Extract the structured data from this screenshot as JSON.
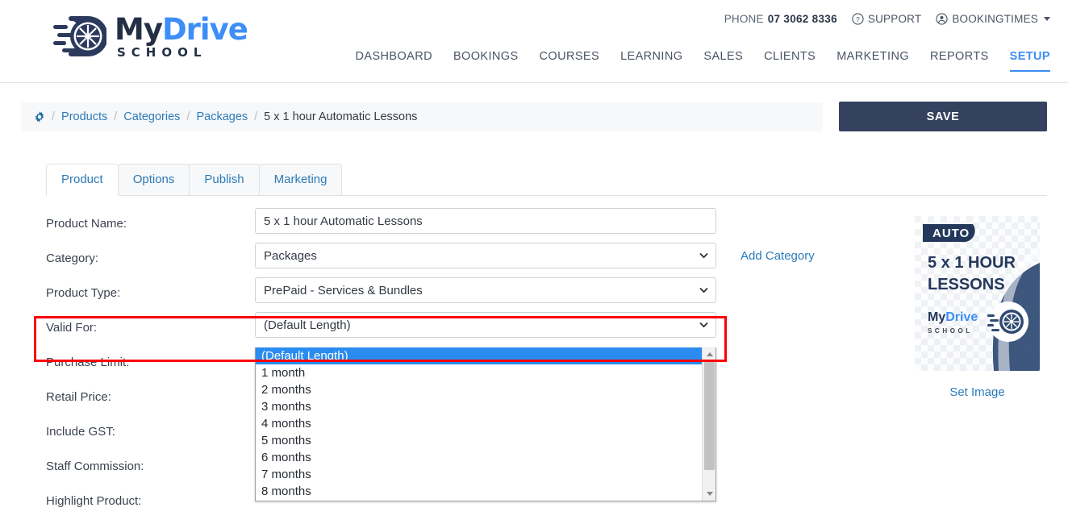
{
  "brand": {
    "logo_my": "My",
    "logo_drive": "Drive",
    "logo_sub": "SCHOOL",
    "logo_icon": "wheel-speed-icon",
    "accent_blue": "#3d8ef7",
    "navy": "#232f45",
    "link_blue": "#2b7bb9",
    "highlight_red": "#fb0007",
    "select_blue": "#2a8cf0"
  },
  "header": {
    "phone_label": "PHONE",
    "phone_number": "07 3062 8336",
    "support_label": "SUPPORT",
    "support_icon": "question-circle-icon",
    "account_label": "BOOKINGTIMES",
    "account_icon": "user-circle-icon",
    "account_caret_icon": "caret-down-icon"
  },
  "nav": {
    "items": [
      {
        "label": "DASHBOARD",
        "active": false
      },
      {
        "label": "BOOKINGS",
        "active": false
      },
      {
        "label": "COURSES",
        "active": false
      },
      {
        "label": "LEARNING",
        "active": false
      },
      {
        "label": "SALES",
        "active": false
      },
      {
        "label": "CLIENTS",
        "active": false
      },
      {
        "label": "MARKETING",
        "active": false
      },
      {
        "label": "REPORTS",
        "active": false
      },
      {
        "label": "SETUP",
        "active": true
      }
    ]
  },
  "breadcrumb": {
    "gear_icon": "gear-icon",
    "separator": "/",
    "items": [
      {
        "label": "Products",
        "link": true
      },
      {
        "label": "Categories",
        "link": true
      },
      {
        "label": "Packages",
        "link": true
      },
      {
        "label": "5 x 1 hour Automatic Lessons",
        "link": false
      }
    ]
  },
  "toolbar": {
    "save_label": "SAVE"
  },
  "tabs": [
    {
      "label": "Product",
      "active": true
    },
    {
      "label": "Options",
      "active": false
    },
    {
      "label": "Publish",
      "active": false
    },
    {
      "label": "Marketing",
      "active": false
    }
  ],
  "form": {
    "product_name": {
      "label": "Product Name:",
      "value": "5 x 1 hour Automatic Lessons",
      "placeholder": ""
    },
    "category": {
      "label": "Category:",
      "value": "Packages",
      "caret_icon": "chevron-down-icon"
    },
    "add_category_link": "Add Category",
    "product_type": {
      "label": "Product Type:",
      "value": "PrePaid - Services & Bundles",
      "caret_icon": "chevron-down-icon"
    },
    "valid_for": {
      "label": "Valid For:",
      "value": "(Default Length)",
      "caret_icon": "chevron-down-icon",
      "highlighted": true
    },
    "purchase_limit": {
      "label": "Purchase Limit:"
    },
    "retail_price": {
      "label": "Retail Price:"
    },
    "include_gst": {
      "label": "Include GST:"
    },
    "staff_commission": {
      "label": "Staff Commission:"
    },
    "highlight_product": {
      "label": "Highlight Product:"
    }
  },
  "valid_for_dropdown": {
    "open": true,
    "selected": "(Default Length)",
    "options": [
      "(Default Length)",
      "1 month",
      "2 months",
      "3 months",
      "4 months",
      "5 months",
      "6 months",
      "7 months",
      "8 months"
    ],
    "scrollbar_up_icon": "triangle-up-icon",
    "scrollbar_down_icon": "triangle-down-icon"
  },
  "product_image": {
    "badge": "AUTO",
    "line1": "5 x 1 HOUR",
    "line2": "LESSONS",
    "logo_my": "My",
    "logo_drive": "Drive",
    "logo_sub": "SCHOOL",
    "set_image_label": "Set Image"
  }
}
